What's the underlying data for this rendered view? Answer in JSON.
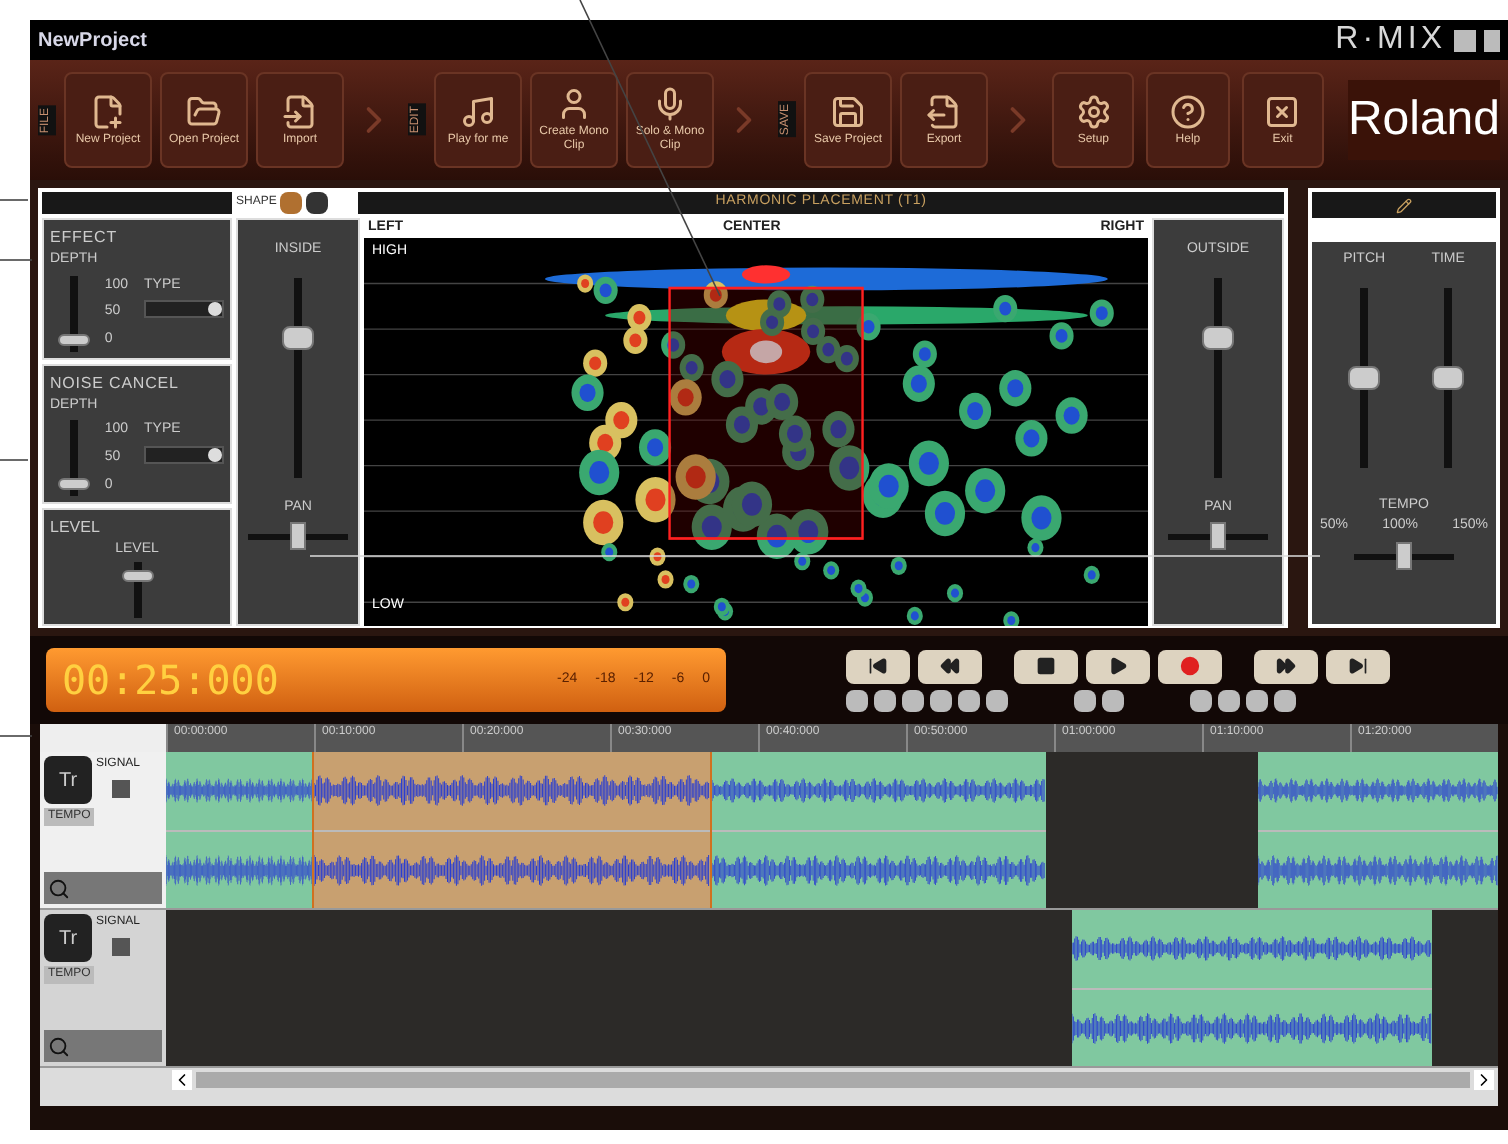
{
  "window": {
    "title": "NewProject",
    "brand": "R·MIX"
  },
  "toolbar": {
    "groups": [
      {
        "label": "FILE",
        "buttons": [
          {
            "label": "New Project",
            "kind": "new"
          },
          {
            "label": "Open Project",
            "kind": "open"
          },
          {
            "label": "Import",
            "kind": "import"
          }
        ]
      },
      {
        "label": "EDIT",
        "buttons": [
          {
            "label": "Play for me",
            "kind": "play"
          },
          {
            "label": "Create Mono Clip",
            "kind": "create"
          },
          {
            "label": "Solo & Mono Clip",
            "kind": "solo"
          }
        ]
      },
      {
        "label": "SAVE",
        "buttons": [
          {
            "label": "Save Project",
            "kind": "save"
          },
          {
            "label": "Export",
            "kind": "export"
          }
        ]
      }
    ],
    "tools": [
      {
        "label": "Setup",
        "kind": "setup"
      },
      {
        "label": "Help",
        "kind": "help"
      },
      {
        "label": "Exit",
        "kind": "exit"
      }
    ],
    "logo": "Roland"
  },
  "shape": {
    "label": "SHAPE",
    "buttons": [
      {
        "selected": true
      },
      {
        "selected": false
      }
    ]
  },
  "effect": {
    "title": "EFFECT",
    "depth": "DEPTH",
    "type": "TYPE",
    "ticks": [
      "100",
      "50",
      "0"
    ],
    "level": 0.15
  },
  "noise_cancel": {
    "title": "NOISE CANCEL",
    "depth": "DEPTH",
    "type": "TYPE",
    "ticks": [
      "100",
      "50",
      "0"
    ],
    "level": 0.15
  },
  "level_panel": {
    "title": "LEVEL",
    "label": "LEVEL",
    "level": 0.75
  },
  "inside": {
    "title": "INSIDE",
    "level": 0.7,
    "pan": {
      "label": "PAN",
      "level": 0.5
    }
  },
  "placement": {
    "title": "HARMONIC PLACEMENT (T1)",
    "left": "LEFT",
    "center": "CENTER",
    "right": "RIGHT",
    "high": "HIGH",
    "low": "LOW"
  },
  "outside": {
    "title": "OUTSIDE",
    "level": 0.7,
    "pan": {
      "label": "PAN",
      "level": 0.5
    }
  },
  "pitch_time": {
    "faders": [
      {
        "label": "PITCH",
        "level": 0.5
      },
      {
        "label": "TIME",
        "level": 0.5
      }
    ],
    "tempo": {
      "label": "TEMPO",
      "ticks": [
        "50%",
        "100%",
        "150%"
      ],
      "level": 0.5
    }
  },
  "transport": {
    "time": "00:25:000",
    "meter": [
      "-24",
      "-18",
      "-12",
      "-6",
      "0"
    ],
    "buttons": [
      {
        "kind": "start"
      },
      {
        "kind": "rewind"
      },
      {
        "kind": "stop"
      },
      {
        "kind": "play"
      },
      {
        "kind": "record"
      },
      {
        "kind": "forward"
      },
      {
        "kind": "end"
      }
    ]
  },
  "timeline": {
    "ruler": [
      "00:00:000",
      "00:10:000",
      "00:20:000",
      "00:30:000",
      "00:40:000",
      "00:50:000",
      "01:00:000",
      "01:10:000",
      "01:20:000"
    ],
    "tracks": [
      {
        "icon": "Tr",
        "signal": "SIGNAL",
        "tempo": "TEMPO",
        "selected": true
      },
      {
        "icon": "Tr",
        "signal": "SIGNAL",
        "tempo": "TEMPO",
        "selected": false
      }
    ]
  }
}
